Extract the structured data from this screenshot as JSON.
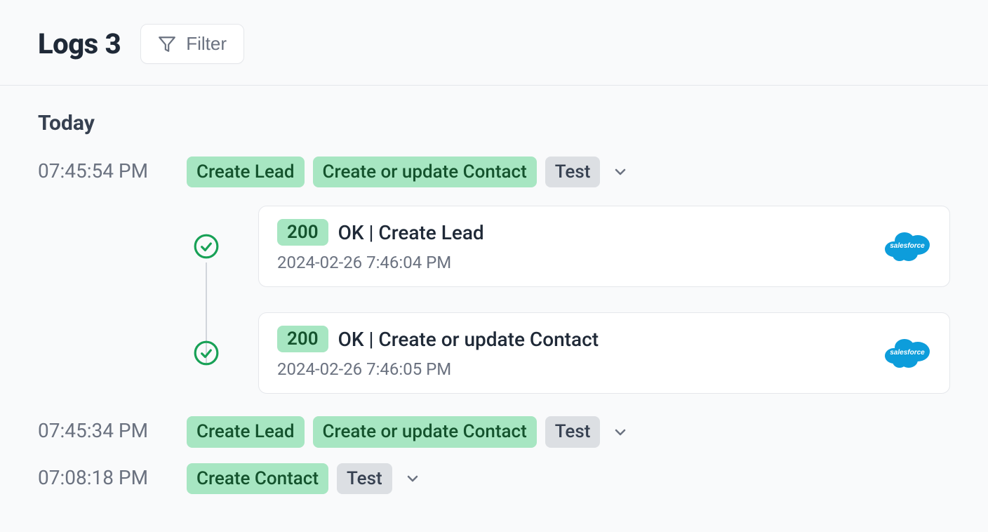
{
  "header": {
    "title": "Logs",
    "count": "3",
    "filter_label": "Filter"
  },
  "section": {
    "heading": "Today"
  },
  "entries": [
    {
      "time": "07:45:54 PM",
      "tags": [
        {
          "label": "Create Lead",
          "variant": "green"
        },
        {
          "label": "Create or update Contact",
          "variant": "green"
        },
        {
          "label": "Test",
          "variant": "gray"
        }
      ],
      "expanded": true,
      "steps": [
        {
          "status_code": "200",
          "title": "OK | Create Lead",
          "timestamp": "2024-02-26 7:46:04 PM",
          "provider": "salesforce"
        },
        {
          "status_code": "200",
          "title": "OK | Create or update Contact",
          "timestamp": "2024-02-26 7:46:05 PM",
          "provider": "salesforce"
        }
      ]
    },
    {
      "time": "07:45:34 PM",
      "tags": [
        {
          "label": "Create Lead",
          "variant": "green"
        },
        {
          "label": "Create or update Contact",
          "variant": "green"
        },
        {
          "label": "Test",
          "variant": "gray"
        }
      ],
      "expanded": false
    },
    {
      "time": "07:08:18 PM",
      "tags": [
        {
          "label": "Create Contact",
          "variant": "green"
        },
        {
          "label": "Test",
          "variant": "gray"
        }
      ],
      "expanded": false
    }
  ]
}
